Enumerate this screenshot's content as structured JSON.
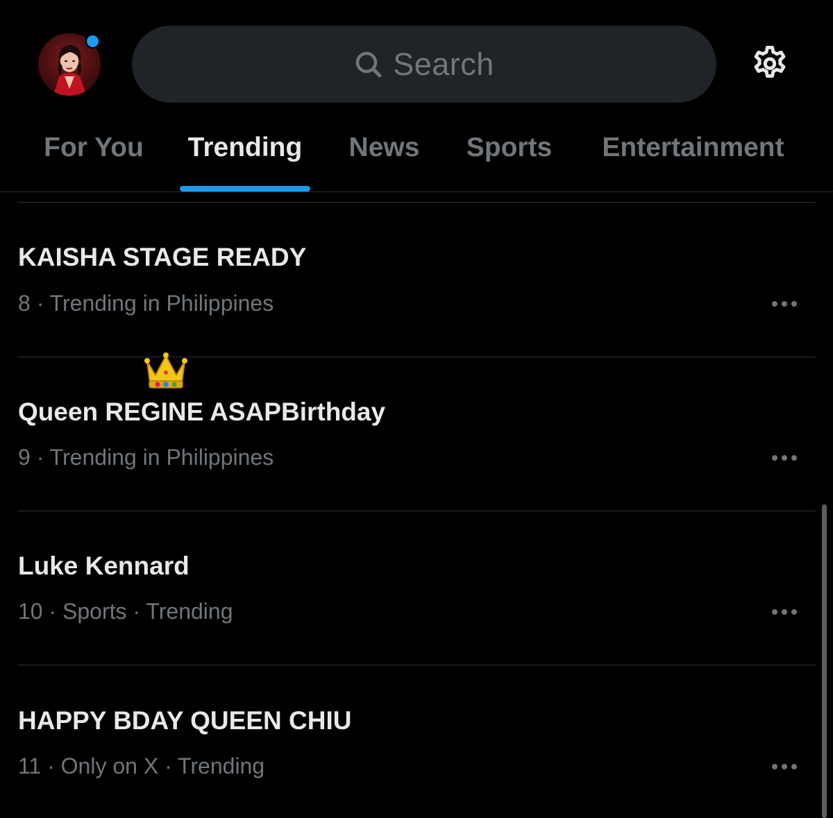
{
  "header": {
    "search_placeholder": "Search"
  },
  "tabs": [
    {
      "label": "For You",
      "active": false
    },
    {
      "label": "Trending",
      "active": true
    },
    {
      "label": "News",
      "active": false
    },
    {
      "label": "Sports",
      "active": false
    },
    {
      "label": "Entertainment",
      "active": false
    }
  ],
  "trends": [
    {
      "title": "KAISHA STAGE READY",
      "meta": "8 · Trending in Philippines"
    },
    {
      "title": "Queen REGINE ASAPBirthday",
      "meta": "9 · Trending in Philippines",
      "emoji": "crown-icon"
    },
    {
      "title": "Luke Kennard",
      "meta": "10 · Sports · Trending"
    },
    {
      "title": "HAPPY BDAY QUEEN CHIU",
      "meta": "11 · Only on X · Trending"
    }
  ],
  "colors": {
    "background": "#000000",
    "accent": "#1d9bf0",
    "text_primary": "#e7e9ea",
    "text_secondary": "#71767b",
    "divider": "#2f3336",
    "search_bg": "#202327"
  }
}
